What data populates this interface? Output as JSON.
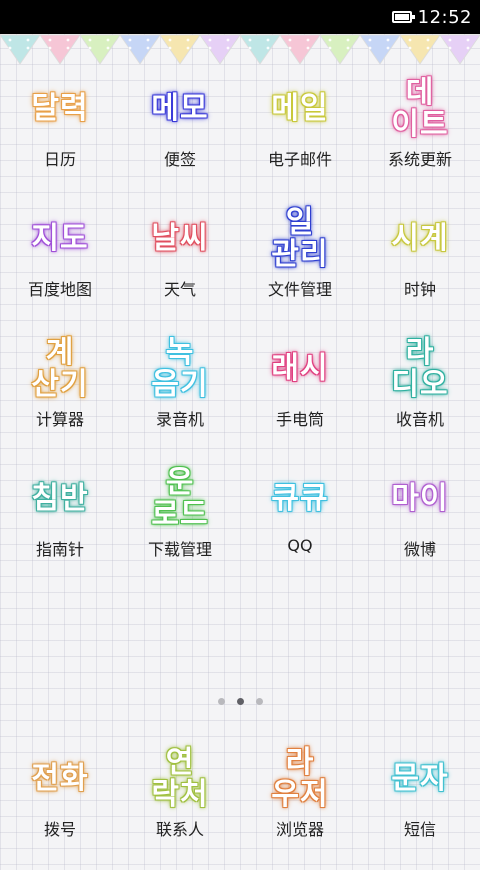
{
  "status": {
    "time": "12:52",
    "battery_level": 1.0
  },
  "apps": [
    {
      "label": "日历",
      "word_lines": [
        "달력"
      ],
      "glow": "#e8a04a"
    },
    {
      "label": "便签",
      "word_lines": [
        "메모"
      ],
      "glow": "#3a3ad8"
    },
    {
      "label": "电子邮件",
      "word_lines": [
        "메일"
      ],
      "glow": "#c8c83a"
    },
    {
      "label": "系统更新",
      "word_lines": [
        "데",
        "이트"
      ],
      "glow": "#e060a0"
    },
    {
      "label": "百度地图",
      "word_lines": [
        "지도"
      ],
      "glow": "#a050d8"
    },
    {
      "label": "天气",
      "word_lines": [
        "날씨"
      ],
      "glow": "#e05060"
    },
    {
      "label": "文件管理",
      "word_lines": [
        "일",
        "관리"
      ],
      "glow": "#3040d0"
    },
    {
      "label": "时钟",
      "word_lines": [
        "시계"
      ],
      "glow": "#c8c840"
    },
    {
      "label": "计算器",
      "word_lines": [
        "계",
        "산기"
      ],
      "glow": "#e0a040"
    },
    {
      "label": "录音机",
      "word_lines": [
        "녹",
        "음기"
      ],
      "glow": "#40c0e0"
    },
    {
      "label": "手电筒",
      "word_lines": [
        "래시"
      ],
      "glow": "#e04080"
    },
    {
      "label": "收音机",
      "word_lines": [
        "라",
        "디오"
      ],
      "glow": "#30b0a0"
    },
    {
      "label": "指南针",
      "word_lines": [
        "침반"
      ],
      "glow": "#40b0a0"
    },
    {
      "label": "下载管理",
      "word_lines": [
        "운",
        "로드"
      ],
      "glow": "#50c050"
    },
    {
      "label": "QQ",
      "word_lines": [
        "큐큐"
      ],
      "glow": "#40c0e0"
    },
    {
      "label": "微博",
      "word_lines": [
        "마이"
      ],
      "glow": "#b060d0"
    }
  ],
  "pager": {
    "count": 3,
    "active": 1
  },
  "dock": [
    {
      "label": "拨号",
      "word_lines": [
        "전화"
      ],
      "glow": "#e0a050"
    },
    {
      "label": "联系人",
      "word_lines": [
        "연",
        "락처"
      ],
      "glow": "#a0c040"
    },
    {
      "label": "浏览器",
      "word_lines": [
        "라",
        "우저"
      ],
      "glow": "#e08040"
    },
    {
      "label": "短信",
      "word_lines": [
        "문자"
      ],
      "glow": "#40c0d0"
    }
  ]
}
